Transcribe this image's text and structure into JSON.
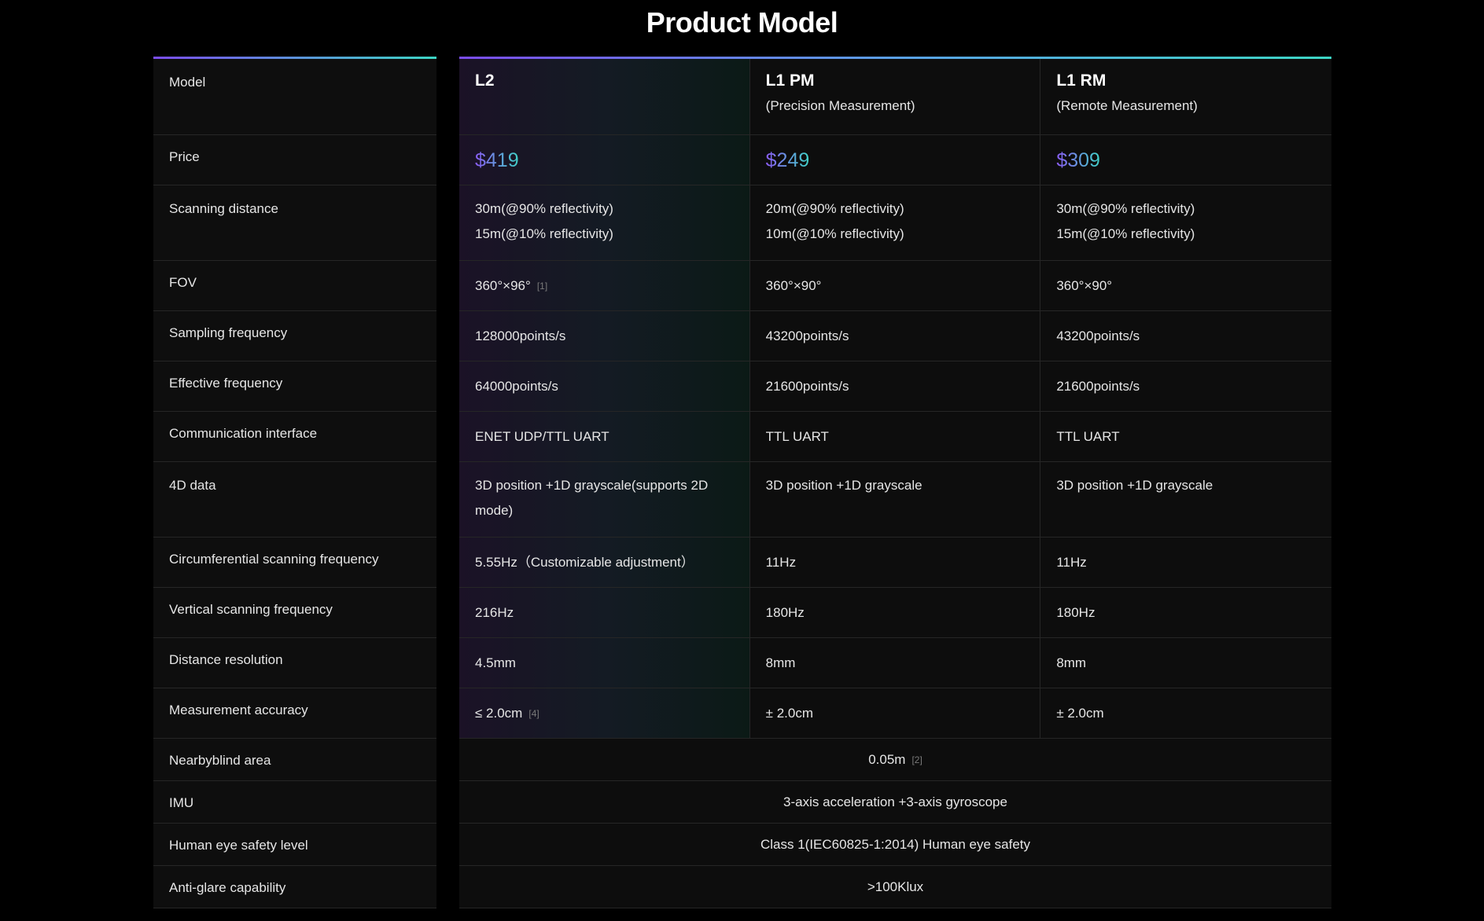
{
  "title": "Product Model",
  "labels": [
    "Model",
    "Price",
    "Scanning distance",
    "FOV",
    "Sampling frequency",
    "Effective frequency",
    "Communication interface",
    "4D data",
    "Circumferential scanning frequency",
    "Vertical scanning frequency",
    "Distance resolution",
    "Measurement accuracy",
    "Nearbyblind area",
    "IMU",
    "Human eye safety level",
    "Anti-glare capability"
  ],
  "models": [
    {
      "name": "L2",
      "subtitle": "",
      "price": "$419",
      "scan_line1": "30m(@90% reflectivity)",
      "scan_line2": "15m(@10% reflectivity)",
      "fov": "360°×96°",
      "fov_note": "[1]",
      "sampling": "128000points/s",
      "effective": "64000points/s",
      "interface": "ENET UDP/TTL UART",
      "data4d": "3D position +1D grayscale(supports 2D mode)",
      "circ_freq": "5.55Hz（Customizable adjustment）",
      "vert_freq": "216Hz",
      "resolution": "4.5mm",
      "accuracy": "≤ 2.0cm",
      "accuracy_note": "[4]"
    },
    {
      "name": "L1 PM",
      "subtitle": "(Precision Measurement)",
      "price": "$249",
      "scan_line1": "20m(@90% reflectivity)",
      "scan_line2": "10m(@10% reflectivity)",
      "fov": "360°×90°",
      "fov_note": "",
      "sampling": "43200points/s",
      "effective": "21600points/s",
      "interface": "TTL UART",
      "data4d": "3D position +1D grayscale",
      "circ_freq": "11Hz",
      "vert_freq": "180Hz",
      "resolution": "8mm",
      "accuracy": "± 2.0cm",
      "accuracy_note": ""
    },
    {
      "name": "L1 RM",
      "subtitle": "(Remote Measurement)",
      "price": "$309",
      "scan_line1": "30m(@90% reflectivity)",
      "scan_line2": "15m(@10% reflectivity)",
      "fov": "360°×90°",
      "fov_note": "",
      "sampling": "43200points/s",
      "effective": "21600points/s",
      "interface": "TTL UART",
      "data4d": "3D position +1D grayscale",
      "circ_freq": "11Hz",
      "vert_freq": "180Hz",
      "resolution": "8mm",
      "accuracy": "± 2.0cm",
      "accuracy_note": ""
    }
  ],
  "shared": {
    "blind_area": "0.05m",
    "blind_area_note": "[2]",
    "imu": "3-axis acceleration +3-axis gyroscope",
    "eye_safety": "Class 1(IEC60825-1:2014) Human eye safety",
    "anti_glare": ">100Klux"
  },
  "colors": {
    "background": "#000000",
    "accent_purple": "#8b5cf6",
    "accent_teal": "#3fd2c7"
  }
}
